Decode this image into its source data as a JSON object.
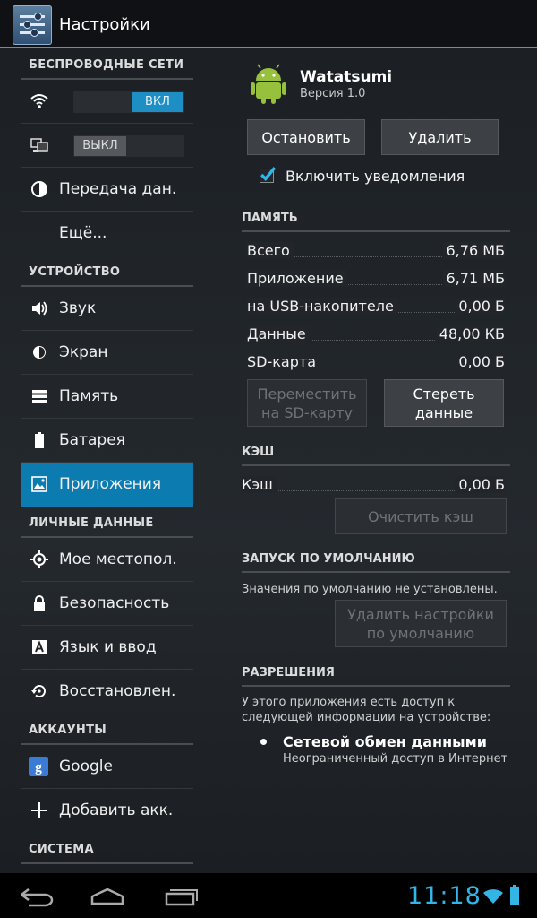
{
  "header": {
    "title": "Настройки",
    "icon": "settings-icon"
  },
  "sidebar": {
    "sections": [
      {
        "title": "БЕСПРОВОДНЫЕ СЕТИ"
      },
      {
        "title": "УСТРОЙСТВО"
      },
      {
        "title": "ЛИЧНЫЕ ДАННЫЕ"
      },
      {
        "title": "АККАУНТЫ"
      },
      {
        "title": "СИСТЕМА"
      }
    ],
    "wifi": {
      "icon": "wifi-icon",
      "toggle_label": "ВКЛ",
      "state": "on"
    },
    "bluetooth": {
      "icon": "bluetooth-devices-icon",
      "toggle_label": "ВЫКЛ",
      "state": "off"
    },
    "items": {
      "data_usage": "Передача дан.",
      "more": "Ещё...",
      "sound": "Звук",
      "display": "Экран",
      "storage": "Память",
      "battery": "Батарея",
      "apps": "Приложения",
      "location": "Мое местопол.",
      "security": "Безопасность",
      "language": "Язык и ввод",
      "backup": "Восстановлен.",
      "google": "Google",
      "add_account": "Добавить акк."
    },
    "active_item": "apps"
  },
  "app": {
    "name": "Watatsumi",
    "version": "Версия 1.0",
    "stop_button": "Остановить",
    "uninstall_button": "Удалить",
    "notifications_label": "Включить уведомления",
    "notifications_checked": true
  },
  "storage": {
    "header": "ПАМЯТЬ",
    "rows": [
      {
        "label": "Всего",
        "value": "6,76 МБ"
      },
      {
        "label": "Приложение",
        "value": "6,71 МБ"
      },
      {
        "label": "на USB-накопителе",
        "value": "0,00 Б"
      },
      {
        "label": "Данные",
        "value": "48,00 КБ"
      },
      {
        "label": "SD-карта",
        "value": "0,00 Б"
      }
    ],
    "move_button_line1": "Переместить",
    "move_button_line2": "на SD-карту",
    "clear_data_line1": "Стереть",
    "clear_data_line2": "данные"
  },
  "cache": {
    "header": "КЭШ",
    "label": "Кэш",
    "value": "0,00 Б",
    "clear_button": "Очистить кэш"
  },
  "defaults": {
    "header": "ЗАПУСК ПО УМОЛЧАНИЮ",
    "text": "Значения по умолчанию не установлены.",
    "button_line1": "Удалить настройки",
    "button_line2": "по умолчанию"
  },
  "permissions": {
    "header": "РАЗРЕШЕНИЯ",
    "text_line1": "У этого приложения есть доступ к",
    "text_line2": "следующей информации на устройстве:",
    "item_title": "Сетевой обмен данными",
    "item_desc": "Неограниченный доступ в Интернет"
  },
  "statusbar": {
    "time": "11:18",
    "accent": "#33b5e5"
  },
  "colors": {
    "accent": "#33b5e5",
    "selected": "#0c7bb0"
  }
}
